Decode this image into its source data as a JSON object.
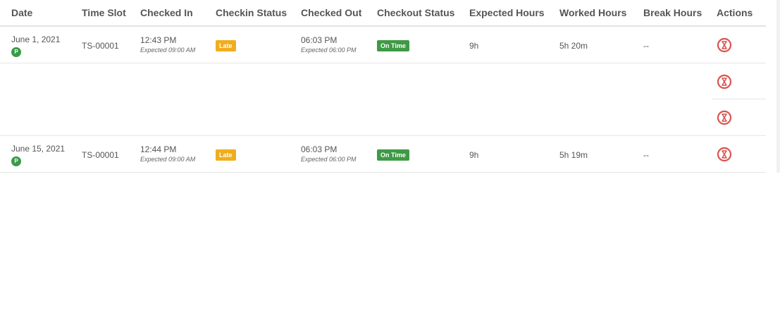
{
  "columns": {
    "date": "Date",
    "time_slot": "Time Slot",
    "checked_in": "Checked In",
    "checkin_status": "Checkin Status",
    "checked_out": "Checked Out",
    "checkout_status": "Checkout Status",
    "expected_hours": "Expected Hours",
    "worked_hours": "Worked Hours",
    "break_hours": "Break Hours",
    "actions": "Actions"
  },
  "rows": [
    {
      "date": "June 1, 2021",
      "badge": "P",
      "time_slot": "TS-00001",
      "checked_in": "12:43 PM",
      "checked_in_expected": "Expected 09:00 AM",
      "checkin_status": "Late",
      "checked_out": "06:03 PM",
      "checked_out_expected": "Expected 06:00 PM",
      "checkout_status": "On Time",
      "expected_hours": "9h",
      "worked_hours": "5h 20m",
      "break_hours": "--",
      "action_icon": "hourglass-icon"
    },
    {
      "action_icon": "hourglass-icon"
    },
    {
      "action_icon": "hourglass-icon"
    },
    {
      "date": "June 15, 2021",
      "badge": "P",
      "time_slot": "TS-00001",
      "checked_in": "12:44 PM",
      "checked_in_expected": "Expected 09:00 AM",
      "checkin_status": "Late",
      "checked_out": "06:03 PM",
      "checked_out_expected": "Expected 06:00 PM",
      "checkout_status": "On Time",
      "expected_hours": "9h",
      "worked_hours": "5h 19m",
      "break_hours": "--",
      "action_icon": "hourglass-icon"
    }
  ],
  "colors": {
    "late": "#f0ad1e",
    "on_time": "#3f9a46",
    "present_badge": "#3a9a4a",
    "action_icon": "#d9534f"
  }
}
